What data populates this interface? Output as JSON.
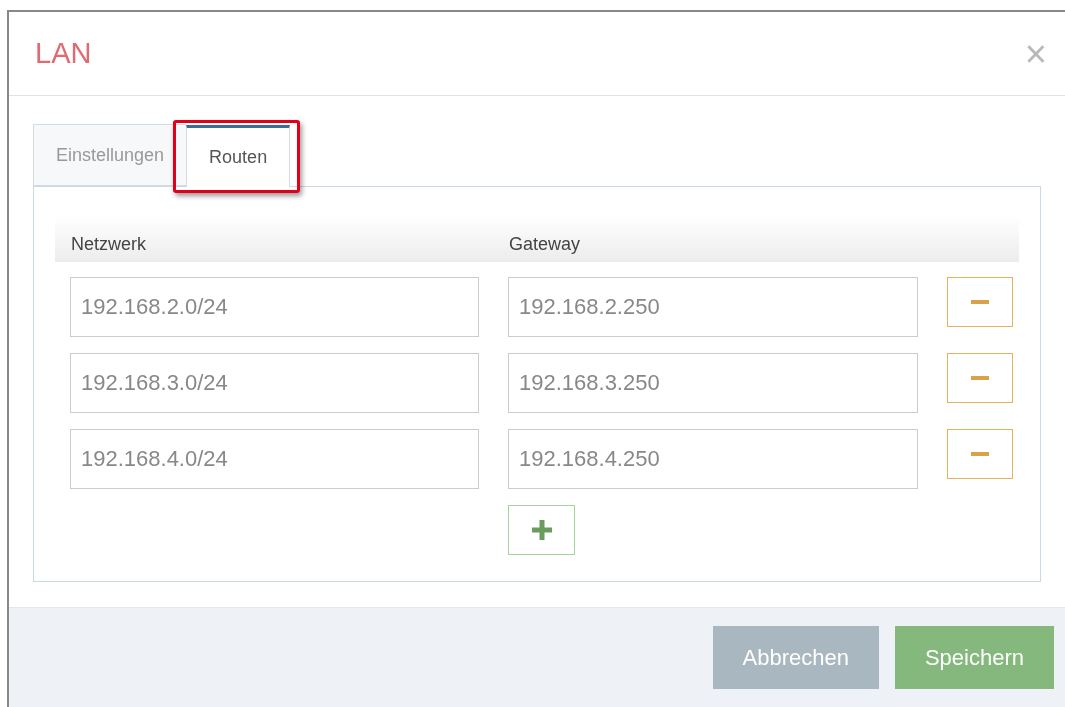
{
  "dialog": {
    "title": "LAN",
    "close_label": "×"
  },
  "tabs": [
    {
      "label": "Einstellungen",
      "selected": false,
      "highlighted": false
    },
    {
      "label": "Routen",
      "selected": true,
      "highlighted": true
    }
  ],
  "routes": {
    "columns": [
      "Netzwerk",
      "Gateway"
    ],
    "rows": [
      {
        "network": "192.168.2.0/24",
        "gateway": "192.168.2.250"
      },
      {
        "network": "192.168.3.0/24",
        "gateway": "192.168.3.250"
      },
      {
        "network": "192.168.4.0/24",
        "gateway": "192.168.4.250"
      }
    ]
  },
  "buttons": [
    {
      "label": "Abbrechen",
      "kind": "secondary"
    },
    {
      "label": "Speichern",
      "kind": "primary"
    }
  ]
}
